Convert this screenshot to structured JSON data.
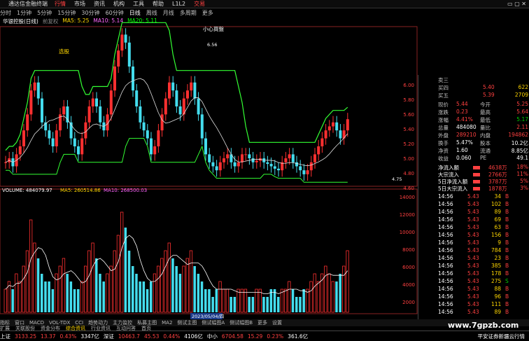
{
  "app": {
    "name": "通达信金融终端",
    "menus": [
      "行情",
      "市场",
      "资讯",
      "机构",
      "工具",
      "帮助",
      "L1L2"
    ],
    "trade": "交易",
    "controls": "▭ ▢ ✕"
  },
  "period_bar": [
    "分时",
    "1分钟",
    "5分钟",
    "15分钟",
    "30分钟",
    "60分钟",
    "日线",
    "周线",
    "月线",
    "多周期",
    "更多"
  ],
  "ma_legend": {
    "title": "华银控股(日线)",
    "ma_fz": "前复权",
    "ma5": "MA5: 5.25",
    "ma10": "MA10: 5.14",
    "ma20": "MA20: 5.11"
  },
  "annotations": {
    "top": "小心買盤",
    "left": "选股",
    "high": "6.56",
    "low": "4.75"
  },
  "volume_legend": {
    "label": "VOLUME: 484079.97",
    "ma5": "MA5: 260514.86",
    "ma10": "MA10: 268500.03"
  },
  "price_axis": [
    "6.00",
    "5.80",
    "5.60",
    "5.40",
    "5.20",
    "5.00",
    "4.80",
    "4.60"
  ],
  "volume_axis": [
    "14000",
    "12000",
    "10000",
    "8000",
    "6000",
    "4000",
    "2000"
  ],
  "volume_cursor": "10898",
  "date_label": "2023/05/04/四",
  "bottom_tabs": [
    "指标",
    "窗口",
    "MACD",
    "VOL-TDX",
    "CCI",
    "趋势动力",
    "主力监控",
    "私募主图",
    "MA2",
    "侧试主图",
    "侧试幅图A",
    "侧试幅图B",
    "更多",
    "设置"
  ],
  "bottom_tabs2": [
    "扩展",
    "关联股份",
    "资金分布",
    "综合资讯",
    "行业资讯",
    "互动问答",
    "首页"
  ],
  "quote": {
    "asks": [
      {
        "label": "卖三",
        "price": "",
        "vol": ""
      },
      {
        "label": "买四",
        "price": "5.40",
        "vol": "622"
      },
      {
        "label": "买五",
        "price": "5.39",
        "vol": "2709"
      }
    ],
    "rows": [
      [
        "现价",
        "5.44",
        "今开",
        "5.25"
      ],
      [
        "涨跌",
        "0.23",
        "最高",
        "5.64"
      ],
      [
        "涨幅",
        "4.41%",
        "最低",
        "5.17"
      ],
      [
        "总量",
        "484080",
        "量比",
        "2.11"
      ],
      [
        "外盘",
        "289210",
        "内盘",
        "194862"
      ],
      [
        "换手",
        "5.47%",
        "股本",
        "10.2亿"
      ],
      [
        "净资",
        "1.60",
        "流通",
        "8.85亿"
      ],
      [
        "收益",
        "0.060",
        "PE",
        "49.1"
      ]
    ],
    "flows": [
      [
        "净流入额",
        "4638万",
        "18%"
      ],
      [
        "大宗流入",
        "2766万",
        "11%"
      ],
      [
        "5日净流入额",
        "3787万",
        "5%"
      ],
      [
        "5日大宗流入",
        "1878万",
        "3%"
      ]
    ],
    "ticks": [
      [
        "14:56",
        "5.43",
        "34",
        "B"
      ],
      [
        "14:56",
        "5.43",
        "102",
        "B"
      ],
      [
        "14:56",
        "5.43",
        "89",
        "B"
      ],
      [
        "14:56",
        "5.43",
        "69",
        "B"
      ],
      [
        "14:56",
        "5.43",
        "63",
        "B"
      ],
      [
        "14:56",
        "5.43",
        "156",
        "B"
      ],
      [
        "14:56",
        "5.43",
        "9",
        "B"
      ],
      [
        "14:56",
        "5.43",
        "784",
        "B"
      ],
      [
        "14:56",
        "5.43",
        "23",
        "B"
      ],
      [
        "14:56",
        "5.43",
        "385",
        "B"
      ],
      [
        "14:56",
        "5.43",
        "178",
        "B"
      ],
      [
        "14:56",
        "5.43",
        "275",
        "S"
      ],
      [
        "14:56",
        "5.43",
        "88",
        "B"
      ],
      [
        "14:56",
        "5.43",
        "96",
        "B"
      ],
      [
        "14:56",
        "5.43",
        "111",
        "B"
      ],
      [
        "14:56",
        "5.43",
        "89",
        "B"
      ],
      [
        "14:56",
        "5.43",
        "3",
        "B"
      ]
    ]
  },
  "statusbar": [
    {
      "name": "上证",
      "value": "3133.25",
      "chg": "13.37",
      "pct": "0.43%",
      "amt": "3347亿"
    },
    {
      "name": "深证",
      "value": "10463.7",
      "chg": "45.53",
      "pct": "0.44%",
      "amt": "4106亿"
    },
    {
      "name": "中小",
      "value": "6704.58",
      "chg": "15.29",
      "pct": "0.23%",
      "amt": "361.6亿"
    }
  ],
  "status_right": "平安证券新疆云行情",
  "watermark": "www.7gpzb.com",
  "colors": {
    "up": "#ff4040",
    "down": "#44ddee",
    "envelope": "#33ff33",
    "ma": "#ffffff"
  }
}
